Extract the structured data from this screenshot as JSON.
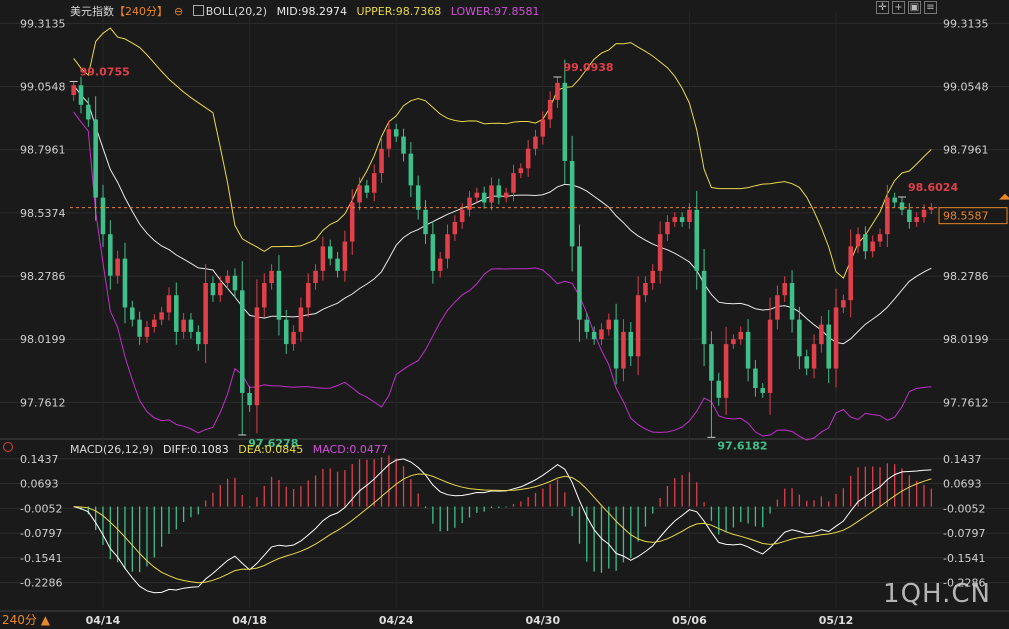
{
  "header": {
    "title": "美元指数",
    "period": "【240分】",
    "boll": "BOLL(20,2)",
    "mid": "MID:98.2974",
    "upper": "UPPER:98.7368",
    "lower": "LOWER:97.8581"
  },
  "macd_header": {
    "label": "MACD(26,12,9)",
    "diff": "DIFF:0.1083",
    "dea": "DEA:0.0845",
    "macd": "MACD:0.0477"
  },
  "footer": {
    "period": "240分 ▲",
    "watermark": "1QH.CN"
  },
  "colors": {
    "background": "#1a1a1a",
    "up": "#e0404a",
    "down": "#3fbf8a",
    "boll_mid": "#e8e8e8",
    "boll_upper": "#e8d84a",
    "boll_lower": "#c030c8",
    "diff": "#ffffff",
    "dea": "#e8d84a",
    "current_price": "#e8872a"
  },
  "chart_data": [
    {
      "type": "candlestick",
      "ylim": [
        97.64,
        99.36
      ],
      "price_ticks": [
        "99.3135",
        "99.0548",
        "98.7961",
        "98.5374",
        "98.2786",
        "98.0199",
        "97.7612"
      ],
      "x_tick_labels": [
        "04/14",
        "04/18",
        "04/24",
        "04/30",
        "05/06",
        "05/12"
      ],
      "x_tick_index": [
        4,
        24,
        44,
        64,
        84,
        104
      ],
      "current_price": 98.5587,
      "current_price_label": "98.5587",
      "annotations": [
        {
          "label": "99.0755",
          "index": 0,
          "value": 99.0755
        },
        {
          "label": "97.6278",
          "index": 23,
          "value": 97.6278
        },
        {
          "label": "99.0938",
          "index": 66,
          "value": 99.0938
        },
        {
          "label": "97.6182",
          "index": 87,
          "value": 97.6182
        },
        {
          "label": "98.6024",
          "index": 113,
          "value": 98.6024
        }
      ],
      "close": [
        99.06,
        98.98,
        98.92,
        98.6,
        98.45,
        98.28,
        98.35,
        98.15,
        98.1,
        98.03,
        98.07,
        98.1,
        98.13,
        98.2,
        98.05,
        98.1,
        98.05,
        98.0,
        98.25,
        98.2,
        98.25,
        98.28,
        98.22,
        97.8,
        97.75,
        98.15,
        98.25,
        98.3,
        98.1,
        98.0,
        98.05,
        98.15,
        98.25,
        98.3,
        98.4,
        98.35,
        98.3,
        98.42,
        98.58,
        98.65,
        98.62,
        98.7,
        98.8,
        98.88,
        98.85,
        98.78,
        98.65,
        98.55,
        98.45,
        98.3,
        98.35,
        98.45,
        98.5,
        98.55,
        98.6,
        98.62,
        98.58,
        98.65,
        98.6,
        98.62,
        98.7,
        98.72,
        98.8,
        98.85,
        98.92,
        99.0,
        99.07,
        98.75,
        98.4,
        98.1,
        98.05,
        98.02,
        98.06,
        98.1,
        97.9,
        98.05,
        97.95,
        98.2,
        98.25,
        98.3,
        98.45,
        98.5,
        98.52,
        98.5,
        98.55,
        98.3,
        98.0,
        97.85,
        97.78,
        98.0,
        98.02,
        98.05,
        97.9,
        97.82,
        97.8,
        98.1,
        98.2,
        98.25,
        98.1,
        97.95,
        97.9,
        98.0,
        98.08,
        97.9,
        98.15,
        98.18,
        98.4,
        98.45,
        98.38,
        98.42,
        98.45,
        98.6,
        98.58,
        98.55,
        98.5,
        98.52,
        98.55,
        98.56
      ],
      "macd_ticks": [
        "0.1437",
        "0.0693",
        "-0.0052",
        "-0.0797",
        "-0.1541",
        "-0.2286"
      ],
      "macd_ylim": [
        -0.305,
        0.155
      ],
      "diff_last": 0.1083,
      "dea_last": 0.0845,
      "macd_last": 0.0477
    }
  ]
}
